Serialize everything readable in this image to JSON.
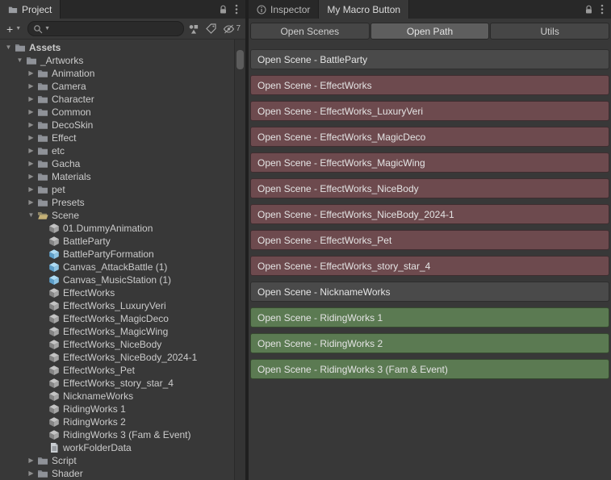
{
  "left_panel": {
    "tab_label": "Project",
    "toolbar": {
      "add_button": "+",
      "search_placeholder": "",
      "hidden_count": "7"
    },
    "tree": [
      {
        "label": "Assets",
        "depth": 0,
        "arrow": "open",
        "icon": "folder",
        "bold": true
      },
      {
        "label": "_Artworks",
        "depth": 1,
        "arrow": "open",
        "icon": "folder"
      },
      {
        "label": "Animation",
        "depth": 2,
        "arrow": "closed",
        "icon": "folder"
      },
      {
        "label": "Camera",
        "depth": 2,
        "arrow": "closed",
        "icon": "folder"
      },
      {
        "label": "Character",
        "depth": 2,
        "arrow": "closed",
        "icon": "folder"
      },
      {
        "label": "Common",
        "depth": 2,
        "arrow": "closed",
        "icon": "folder"
      },
      {
        "label": "DecoSkin",
        "depth": 2,
        "arrow": "closed",
        "icon": "folder"
      },
      {
        "label": "Effect",
        "depth": 2,
        "arrow": "closed",
        "icon": "folder"
      },
      {
        "label": "etc",
        "depth": 2,
        "arrow": "closed",
        "icon": "folder"
      },
      {
        "label": "Gacha",
        "depth": 2,
        "arrow": "closed",
        "icon": "folder"
      },
      {
        "label": "Materials",
        "depth": 2,
        "arrow": "closed",
        "icon": "folder"
      },
      {
        "label": "pet",
        "depth": 2,
        "arrow": "closed",
        "icon": "folder"
      },
      {
        "label": "Presets",
        "depth": 2,
        "arrow": "closed",
        "icon": "folder"
      },
      {
        "label": "Scene",
        "depth": 2,
        "arrow": "open",
        "icon": "folder-open"
      },
      {
        "label": "01.DummyAnimation",
        "depth": 3,
        "arrow": "none",
        "icon": "scene"
      },
      {
        "label": "BattleParty",
        "depth": 3,
        "arrow": "none",
        "icon": "scene"
      },
      {
        "label": "BattlePartyFormation",
        "depth": 3,
        "arrow": "none",
        "icon": "prefab"
      },
      {
        "label": "Canvas_AttackBattle (1)",
        "depth": 3,
        "arrow": "none",
        "icon": "prefab"
      },
      {
        "label": "Canvas_MusicStation (1)",
        "depth": 3,
        "arrow": "none",
        "icon": "prefab"
      },
      {
        "label": "EffectWorks",
        "depth": 3,
        "arrow": "none",
        "icon": "scene"
      },
      {
        "label": "EffectWorks_LuxuryVeri",
        "depth": 3,
        "arrow": "none",
        "icon": "scene"
      },
      {
        "label": "EffectWorks_MagicDeco",
        "depth": 3,
        "arrow": "none",
        "icon": "scene"
      },
      {
        "label": "EffectWorks_MagicWing",
        "depth": 3,
        "arrow": "none",
        "icon": "scene"
      },
      {
        "label": "EffectWorks_NiceBody",
        "depth": 3,
        "arrow": "none",
        "icon": "scene"
      },
      {
        "label": "EffectWorks_NiceBody_2024-1",
        "depth": 3,
        "arrow": "none",
        "icon": "scene"
      },
      {
        "label": "EffectWorks_Pet",
        "depth": 3,
        "arrow": "none",
        "icon": "scene"
      },
      {
        "label": "EffectWorks_story_star_4",
        "depth": 3,
        "arrow": "none",
        "icon": "scene"
      },
      {
        "label": "NicknameWorks",
        "depth": 3,
        "arrow": "none",
        "icon": "scene"
      },
      {
        "label": "RidingWorks 1",
        "depth": 3,
        "arrow": "none",
        "icon": "scene"
      },
      {
        "label": "RidingWorks 2",
        "depth": 3,
        "arrow": "none",
        "icon": "scene"
      },
      {
        "label": "RidingWorks 3 (Fam & Event)",
        "depth": 3,
        "arrow": "none",
        "icon": "scene"
      },
      {
        "label": "workFolderData",
        "depth": 3,
        "arrow": "none",
        "icon": "text-asset"
      },
      {
        "label": "Script",
        "depth": 2,
        "arrow": "closed",
        "icon": "folder"
      },
      {
        "label": "Shader",
        "depth": 2,
        "arrow": "closed",
        "icon": "folder"
      }
    ]
  },
  "right_panel": {
    "tabs": [
      {
        "label": "Inspector"
      },
      {
        "label": "My Macro Button"
      }
    ],
    "active_tab": "My Macro Button",
    "toolbar_tabs": [
      {
        "label": "Open Scenes",
        "selected": false
      },
      {
        "label": "Open Path",
        "selected": true
      },
      {
        "label": "Utils",
        "selected": false
      }
    ],
    "colors": {
      "default": "#4a4a4a",
      "default_border": "#2e2e2e",
      "red": "#6d4a4e",
      "red_border": "#3f2d30",
      "green": "#5b7a52",
      "green_border": "#36492f"
    },
    "buttons": [
      {
        "label": "Open Scene - BattleParty",
        "color": "default"
      },
      {
        "label": "Open Scene - EffectWorks",
        "color": "red"
      },
      {
        "label": "Open Scene - EffectWorks_LuxuryVeri",
        "color": "red"
      },
      {
        "label": "Open Scene - EffectWorks_MagicDeco",
        "color": "red"
      },
      {
        "label": "Open Scene - EffectWorks_MagicWing",
        "color": "red"
      },
      {
        "label": "Open Scene - EffectWorks_NiceBody",
        "color": "red"
      },
      {
        "label": "Open Scene - EffectWorks_NiceBody_2024-1",
        "color": "red"
      },
      {
        "label": "Open Scene - EffectWorks_Pet",
        "color": "red"
      },
      {
        "label": "Open Scene - EffectWorks_story_star_4",
        "color": "red"
      },
      {
        "label": "Open Scene - NicknameWorks",
        "color": "default"
      },
      {
        "label": "Open Scene - RidingWorks 1",
        "color": "green"
      },
      {
        "label": "Open Scene - RidingWorks 2",
        "color": "green"
      },
      {
        "label": "Open Scene - RidingWorks 3 (Fam & Event)",
        "color": "green"
      }
    ]
  }
}
